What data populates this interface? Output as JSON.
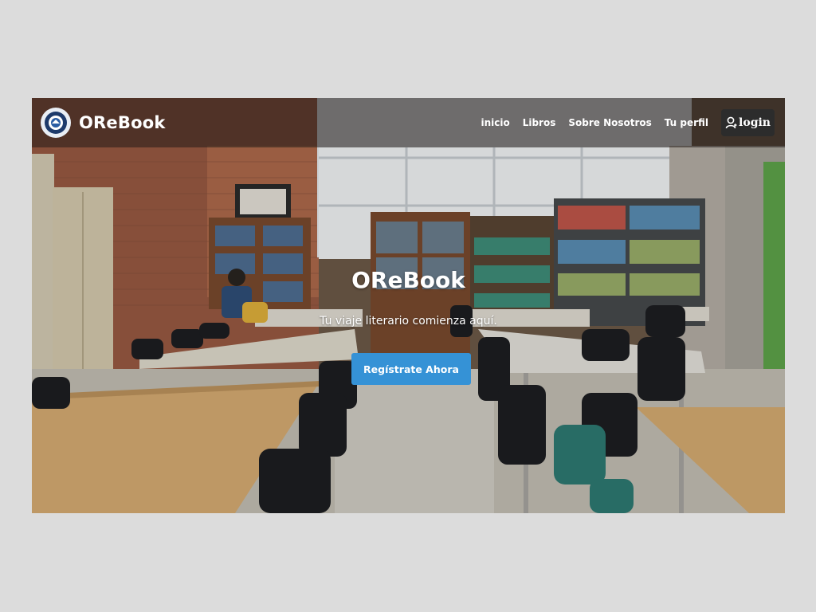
{
  "app": {
    "brand_name": "OReBook"
  },
  "nav": {
    "items": [
      {
        "label": "inicio"
      },
      {
        "label": "Libros"
      },
      {
        "label": "Sobre Nosotros"
      },
      {
        "label": "Tu perfil"
      }
    ],
    "login_label": "login",
    "login_icon": "user-icon"
  },
  "hero": {
    "title": "OReBook",
    "subtitle": "Tu viaje literario comienza aquí.",
    "cta_label": "Regístrate Ahora",
    "cta_color": "#3592d6",
    "background": "library-reading-room-photo"
  },
  "colors": {
    "page_bg": "#dcdcdc",
    "navbar_bg": "#231c18",
    "text": "#ffffff",
    "accent": "#3592d6"
  }
}
